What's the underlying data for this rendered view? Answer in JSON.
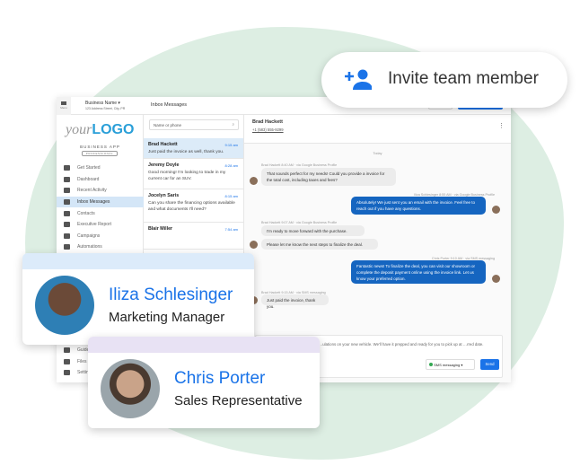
{
  "invite": {
    "label": "Invite team member",
    "icon": "person-add-icon",
    "color": "#1a73e8"
  },
  "topbar": {
    "menu_label": "Menu",
    "business_name": "Business Name",
    "address": "123 Address Street, City, PR",
    "more_label": "More",
    "new_message_label": "New message"
  },
  "sidebar": {
    "logo_your": "your",
    "logo_logo": "LOGO",
    "app_name": "BUSINESS APP",
    "edition": "PROFESSIONAL",
    "items": [
      {
        "label": "Get Started",
        "icon": "rocket-icon"
      },
      {
        "label": "Dashboard",
        "icon": "dashboard-icon"
      },
      {
        "label": "Recent Activity",
        "icon": "history-icon"
      },
      {
        "label": "Inbox Messages",
        "icon": "inbox-icon",
        "active": true
      },
      {
        "label": "Contacts",
        "icon": "contacts-icon"
      },
      {
        "label": "Executive Report",
        "icon": "trend-icon"
      },
      {
        "label": "Campaigns",
        "icon": "mail-icon"
      },
      {
        "label": "Automations",
        "icon": "automation-icon"
      }
    ],
    "bottom_items": [
      {
        "label": "Guides",
        "icon": "guides-icon"
      },
      {
        "label": "Files",
        "icon": "file-icon"
      },
      {
        "label": "Settings",
        "icon": "gear-icon"
      }
    ]
  },
  "inbox": {
    "title": "Inbox Messages",
    "search_placeholder": "Name or phone",
    "conversations": [
      {
        "name": "Brad Hackett",
        "time": "9:15 am",
        "preview": "Just paid the invoice as well, thank you."
      },
      {
        "name": "Jeremy Doyle",
        "time": "8:28 am",
        "preview": "Good morning! I'm looking to trade in my current car for an SUV."
      },
      {
        "name": "Jocelyn Saris",
        "time": "8:15 am",
        "preview": "Can you share the financing options available and what documents I'll need?"
      },
      {
        "name": "Blair Miller",
        "time": "7:54 am",
        "preview": ""
      }
    ]
  },
  "chat": {
    "contact_name": "Brad Hackett",
    "contact_phone": "+1 (583) 555-9299",
    "day_label": "Today",
    "messages": [
      {
        "meta": "Brad Hackett 8:40 AM · via Google Business Profile",
        "texts": [
          "That sounds perfect for my needs! Could you provide a invoice for the total cost, including taxes and fees?"
        ],
        "dir": "in"
      },
      {
        "meta": "Iliza Schlesinger 8:55 AM · via Google Business Profile",
        "texts": [
          "Absolutely! We just sent you an email with the invoice. Feel free to reach out if you have any questions."
        ],
        "dir": "out"
      },
      {
        "meta": "Brad Hackett 9:07 AM · via Google Business Profile",
        "texts": [
          "I'm ready to move forward with the purchase.",
          "Please let me know the next steps to finalize the deal."
        ],
        "dir": "in"
      },
      {
        "meta": "Chris Porter 9:10 AM · via SMS messaging",
        "texts": [
          "Fantastic news! To finalize the deal, you can visit our showroom or complete the deposit payment online using the invoice link. Let us know your preferred option."
        ],
        "dir": "out"
      },
      {
        "meta": "Brad Hackett 9:15 AM · via SMS messaging",
        "texts": [
          "Just paid the invoice, thank you."
        ],
        "dir": "in"
      }
    ],
    "composer_text": "…ulations on your new vehicle. We'll have it prepped and ready for you to pick up at …rred date.",
    "channel_label": "SMS messaging",
    "send_label": "Send"
  },
  "cards": [
    {
      "name": "Iliza Schlesinger",
      "role": "Marketing Manager"
    },
    {
      "name": "Chris Porter",
      "role": "Sales Representative"
    }
  ],
  "colors": {
    "accent": "#1a73e8",
    "blob": "#ddeee3",
    "outgoing_bubble": "#1565c0"
  }
}
